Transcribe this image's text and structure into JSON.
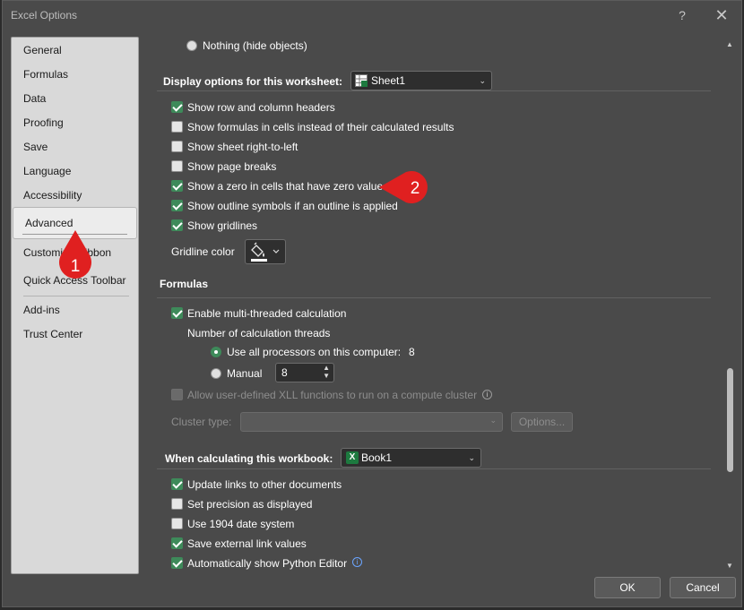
{
  "window": {
    "title": "Excel Options",
    "help_glyph": "?",
    "close_glyph": "✕"
  },
  "nav": {
    "items": [
      {
        "label": "General"
      },
      {
        "label": "Formulas"
      },
      {
        "label": "Data"
      },
      {
        "label": "Proofing"
      },
      {
        "label": "Save"
      },
      {
        "label": "Language"
      },
      {
        "label": "Accessibility"
      },
      {
        "label": "Advanced"
      },
      {
        "label": "Customize Ribbon"
      },
      {
        "label": "Quick Access Toolbar"
      },
      {
        "label": "Add-ins"
      },
      {
        "label": "Trust Center"
      }
    ],
    "selected": "Advanced"
  },
  "objects": {
    "nothing_label": "Nothing (hide objects)"
  },
  "worksheet": {
    "header": "Display options for this worksheet:",
    "sheet_dropdown": "Sheet1",
    "options": [
      {
        "label": "Show row and column headers",
        "checked": true
      },
      {
        "label": "Show formulas in cells instead of their calculated results",
        "checked": false
      },
      {
        "label": "Show sheet right-to-left",
        "checked": false
      },
      {
        "label": "Show page breaks",
        "checked": false
      },
      {
        "label": "Show a zero in cells that have zero value",
        "checked": true
      },
      {
        "label": "Show outline symbols if an outline is applied",
        "checked": true
      },
      {
        "label": "Show gridlines",
        "checked": true
      }
    ],
    "gridline_color_label": "Gridline color"
  },
  "formulas": {
    "header": "Formulas",
    "multithread_label": "Enable multi-threaded calculation",
    "threads_label": "Number of calculation threads",
    "use_all_label": "Use all processors on this computer:",
    "processor_count": "8",
    "manual_label": "Manual",
    "manual_value": "8",
    "xll_label": "Allow user-defined XLL functions to run on a compute cluster",
    "cluster_type_label": "Cluster type:",
    "options_button": "Options..."
  },
  "workbook": {
    "header": "When calculating this workbook:",
    "book_dropdown": "Book1",
    "options": [
      {
        "label": "Update links to other documents",
        "checked": true
      },
      {
        "label": "Set precision as displayed",
        "checked": false
      },
      {
        "label": "Use 1904 date system",
        "checked": false
      },
      {
        "label": "Save external link values",
        "checked": true
      },
      {
        "label": "Automatically show Python Editor",
        "checked": true
      }
    ]
  },
  "buttons": {
    "ok": "OK",
    "cancel": "Cancel"
  },
  "callouts": {
    "one": "1",
    "two": "2",
    "color": "#e02020"
  },
  "icons": {
    "excel_book": "X",
    "chevron": "⌄",
    "info": "i"
  }
}
